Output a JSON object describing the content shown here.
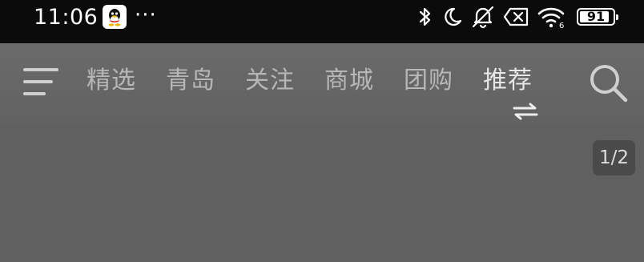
{
  "status_bar": {
    "time": "11:06",
    "more": "···",
    "battery_level": "91",
    "battery_percent": 91,
    "icons": [
      "qq-app-icon",
      "bluetooth-icon",
      "moon-icon",
      "muted-bell-icon",
      "no-sim-icon",
      "wifi-icon",
      "battery-icon"
    ]
  },
  "nav": {
    "tabs": [
      {
        "label": "精选",
        "active": false
      },
      {
        "label": "青岛",
        "active": false
      },
      {
        "label": "关注",
        "active": false
      },
      {
        "label": "商城",
        "active": false
      },
      {
        "label": "团购",
        "active": false
      },
      {
        "label": "推荐",
        "active": true
      }
    ],
    "icons": [
      "menu-icon",
      "switch-icon",
      "search-icon"
    ]
  },
  "content": {
    "page_indicator": "1/2"
  }
}
